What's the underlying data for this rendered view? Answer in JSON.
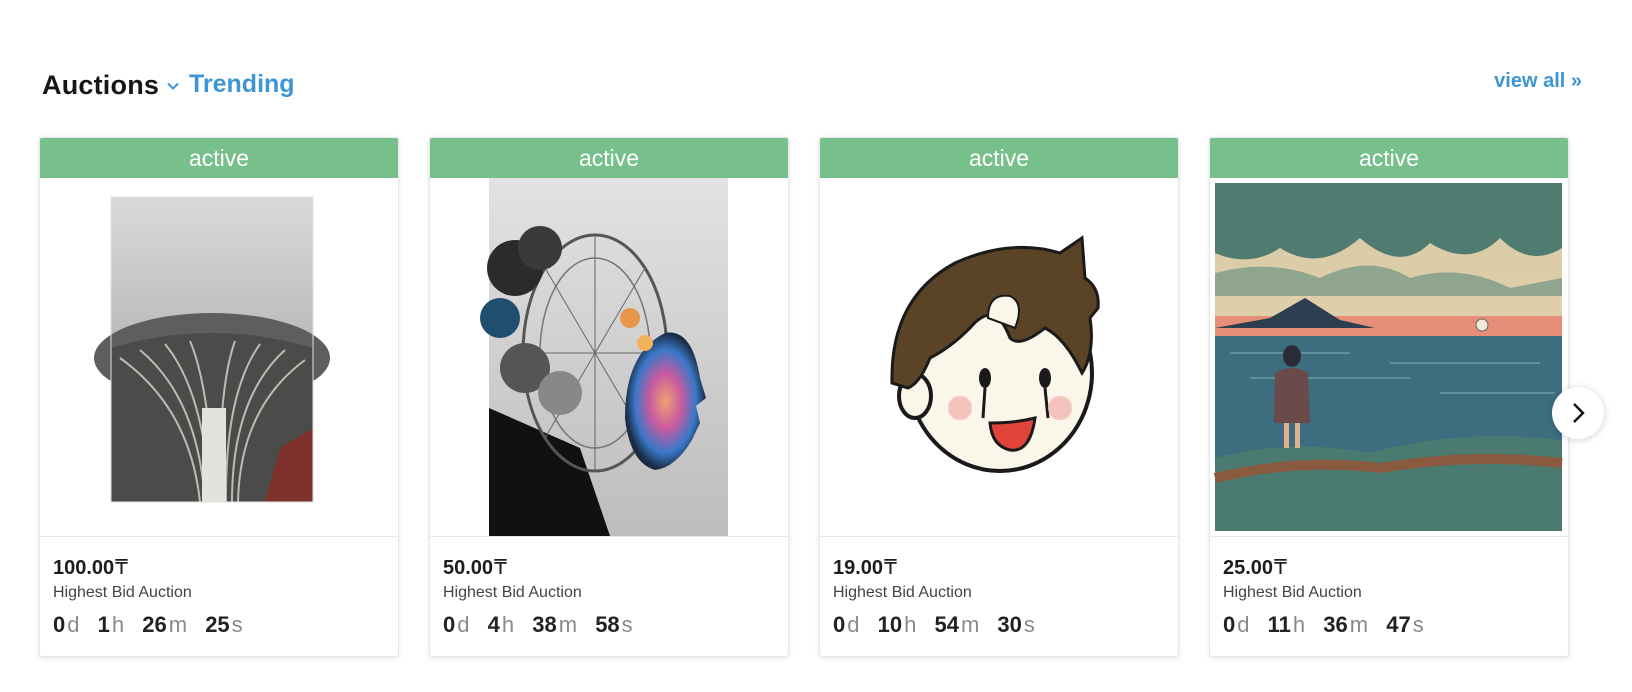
{
  "header": {
    "title": "Auctions",
    "filter_label": "Trending",
    "view_all": "view all »"
  },
  "cards": [
    {
      "status": "active",
      "price": "100.00",
      "currency": "₸",
      "type": "Highest Bid Auction",
      "timer": {
        "d": "0",
        "h": "1",
        "m": "26",
        "s": "25"
      },
      "image": "foggy-spiral-terraces-artwork"
    },
    {
      "status": "active",
      "price": "50.00",
      "currency": "₸",
      "type": "Highest Bid Auction",
      "timer": {
        "d": "0",
        "h": "4",
        "m": "38",
        "s": "58"
      },
      "image": "ferris-wheel-face-smoke-artwork"
    },
    {
      "status": "active",
      "price": "19.00",
      "currency": "₸",
      "type": "Highest Bid Auction",
      "timer": {
        "d": "0",
        "h": "10",
        "m": "54",
        "s": "30"
      },
      "image": "crying-cartoon-face-artwork"
    },
    {
      "status": "active",
      "price": "25.00",
      "currency": "₸",
      "type": "Highest Bid Auction",
      "timer": {
        "d": "0",
        "h": "11",
        "m": "36",
        "s": "47"
      },
      "image": "person-by-sea-sunset-artwork"
    }
  ],
  "units": {
    "d": "d",
    "h": "h",
    "m": "m",
    "s": "s"
  },
  "icons": {
    "filter": "chevron-down-icon",
    "next": "chevron-right-icon"
  },
  "colors": {
    "accent": "#3d96d3",
    "status_bg": "#77bf8b"
  }
}
